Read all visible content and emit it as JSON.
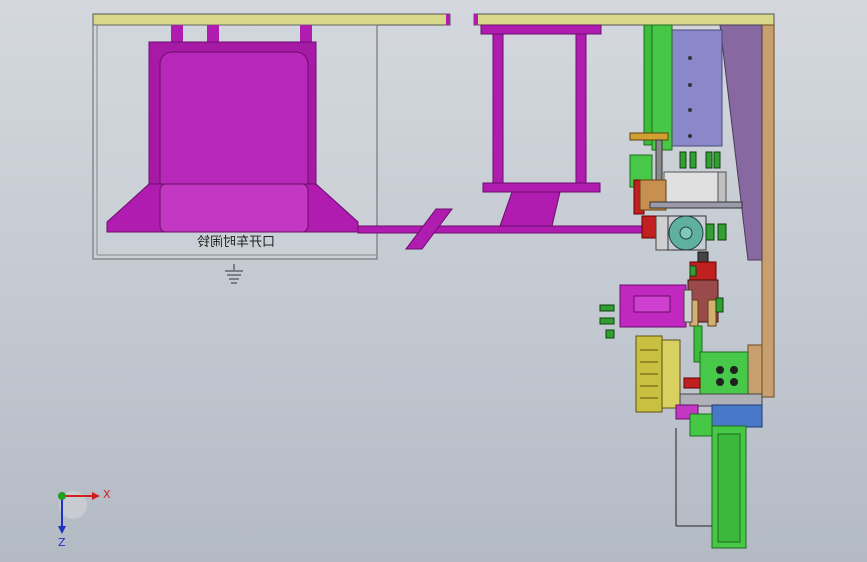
{
  "viewport": {
    "mirrored_label": "口开车时闹铃"
  },
  "triad": {
    "x_label": "X",
    "z_label": "Z"
  },
  "colors": {
    "background_top": "#d4d8de",
    "background_bottom": "#b3bac4",
    "frame_yellow": "#d8d88a",
    "magenta": "#b01cb0",
    "magenta_light": "#c238c2",
    "green": "#3cbe3c",
    "lavender": "#8a88c8",
    "brown": "#c8a070",
    "yellow": "#c8c040",
    "red": "#c02020",
    "axis_x": "#d02020",
    "axis_y": "#20a020",
    "axis_z": "#2030c0"
  }
}
